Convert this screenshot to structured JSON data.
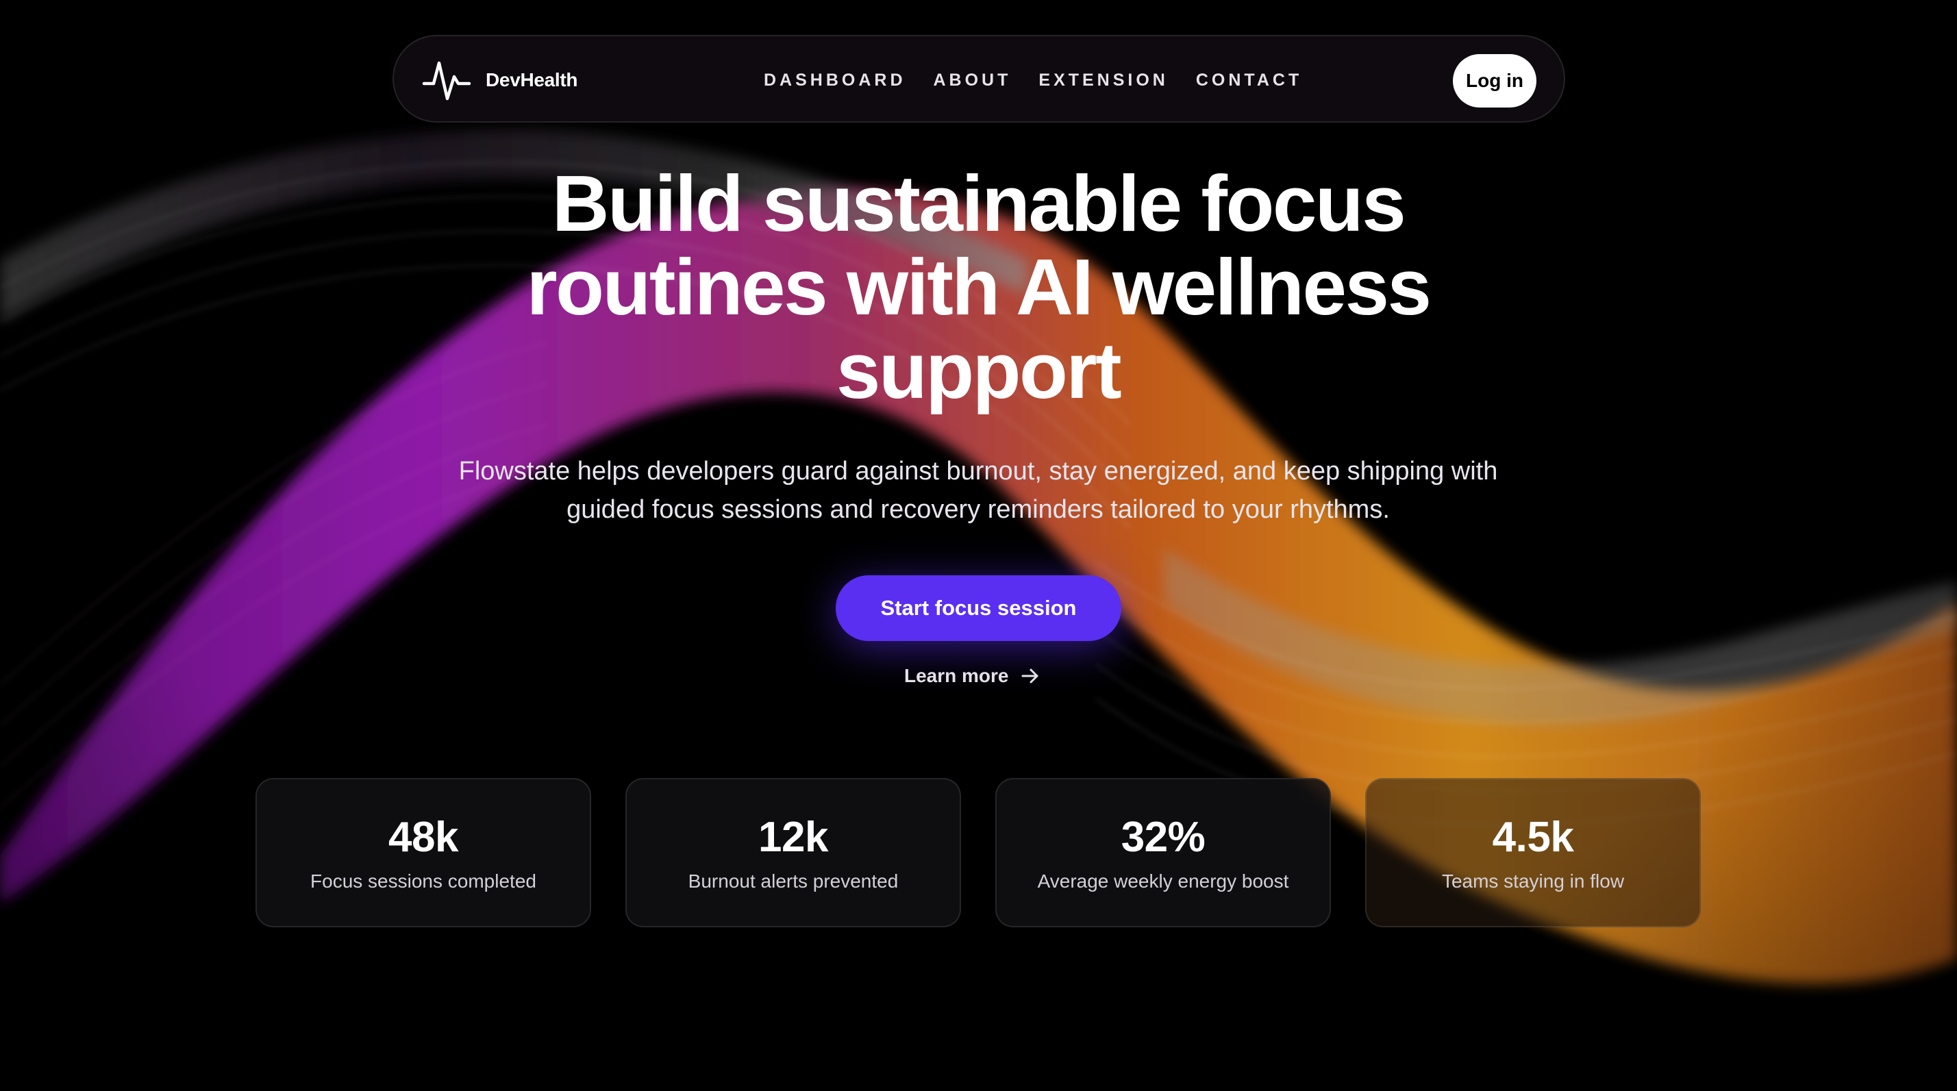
{
  "brand": {
    "name": "DevHealth",
    "logo_icon": "pulse-icon"
  },
  "nav": {
    "links": [
      "DASHBOARD",
      "ABOUT",
      "EXTENSION",
      "CONTACT"
    ],
    "login_label": "Log in"
  },
  "hero": {
    "title": "Build sustainable focus routines with AI wellness support",
    "subtitle": "Flowstate helps developers guard against burnout, stay energized, and keep shipping with guided focus sessions and recovery reminders tailored to your rhythms.",
    "cta_label": "Start focus session",
    "learn_more_label": "Learn more",
    "learn_more_icon": "arrow-right-icon"
  },
  "stats": [
    {
      "value": "48k",
      "label": "Focus sessions completed"
    },
    {
      "value": "12k",
      "label": "Burnout alerts prevented"
    },
    {
      "value": "32%",
      "label": "Average weekly energy boost"
    },
    {
      "value": "4.5k",
      "label": "Teams staying in flow"
    }
  ],
  "colors": {
    "background": "#000000",
    "accent": "#5a2ff2",
    "wave_purple": "#8a1fa8",
    "wave_orange": "#e08a1a"
  }
}
